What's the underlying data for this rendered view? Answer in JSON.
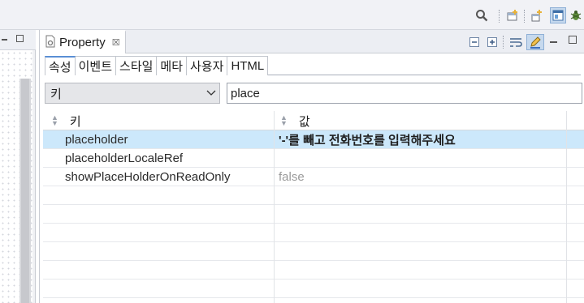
{
  "toolbar": {
    "icons": [
      "search-icon",
      "new-window-icon",
      "open-perspective-icon",
      "editor-perspective-icon",
      "debug-icon"
    ]
  },
  "view": {
    "title": "Property",
    "close_glyph": "☒",
    "header_buttons": [
      "minimize-icon",
      "maximize-icon",
      "wrap-icon",
      "edit-icon"
    ]
  },
  "sub_tabs": [
    "속성",
    "이벤트",
    "스타일",
    "메타",
    "사용자",
    "HTML"
  ],
  "active_sub_tab": "속성",
  "filter": {
    "combo_value": "키",
    "search_value": "place"
  },
  "table": {
    "columns": [
      "키",
      "값"
    ],
    "rows": [
      {
        "key": "placeholder",
        "value": "'-'를 빼고 전화번호를 입력해주세요",
        "selected": true,
        "style": "bold"
      },
      {
        "key": "placeholderLocaleRef",
        "value": "",
        "selected": false,
        "style": "normal"
      },
      {
        "key": "showPlaceHolderOnReadOnly",
        "value": "false",
        "selected": false,
        "style": "muted"
      }
    ],
    "empty_rows": 5
  },
  "colors": {
    "accent": "#5a8fd5",
    "selection": "#cce8fb"
  }
}
